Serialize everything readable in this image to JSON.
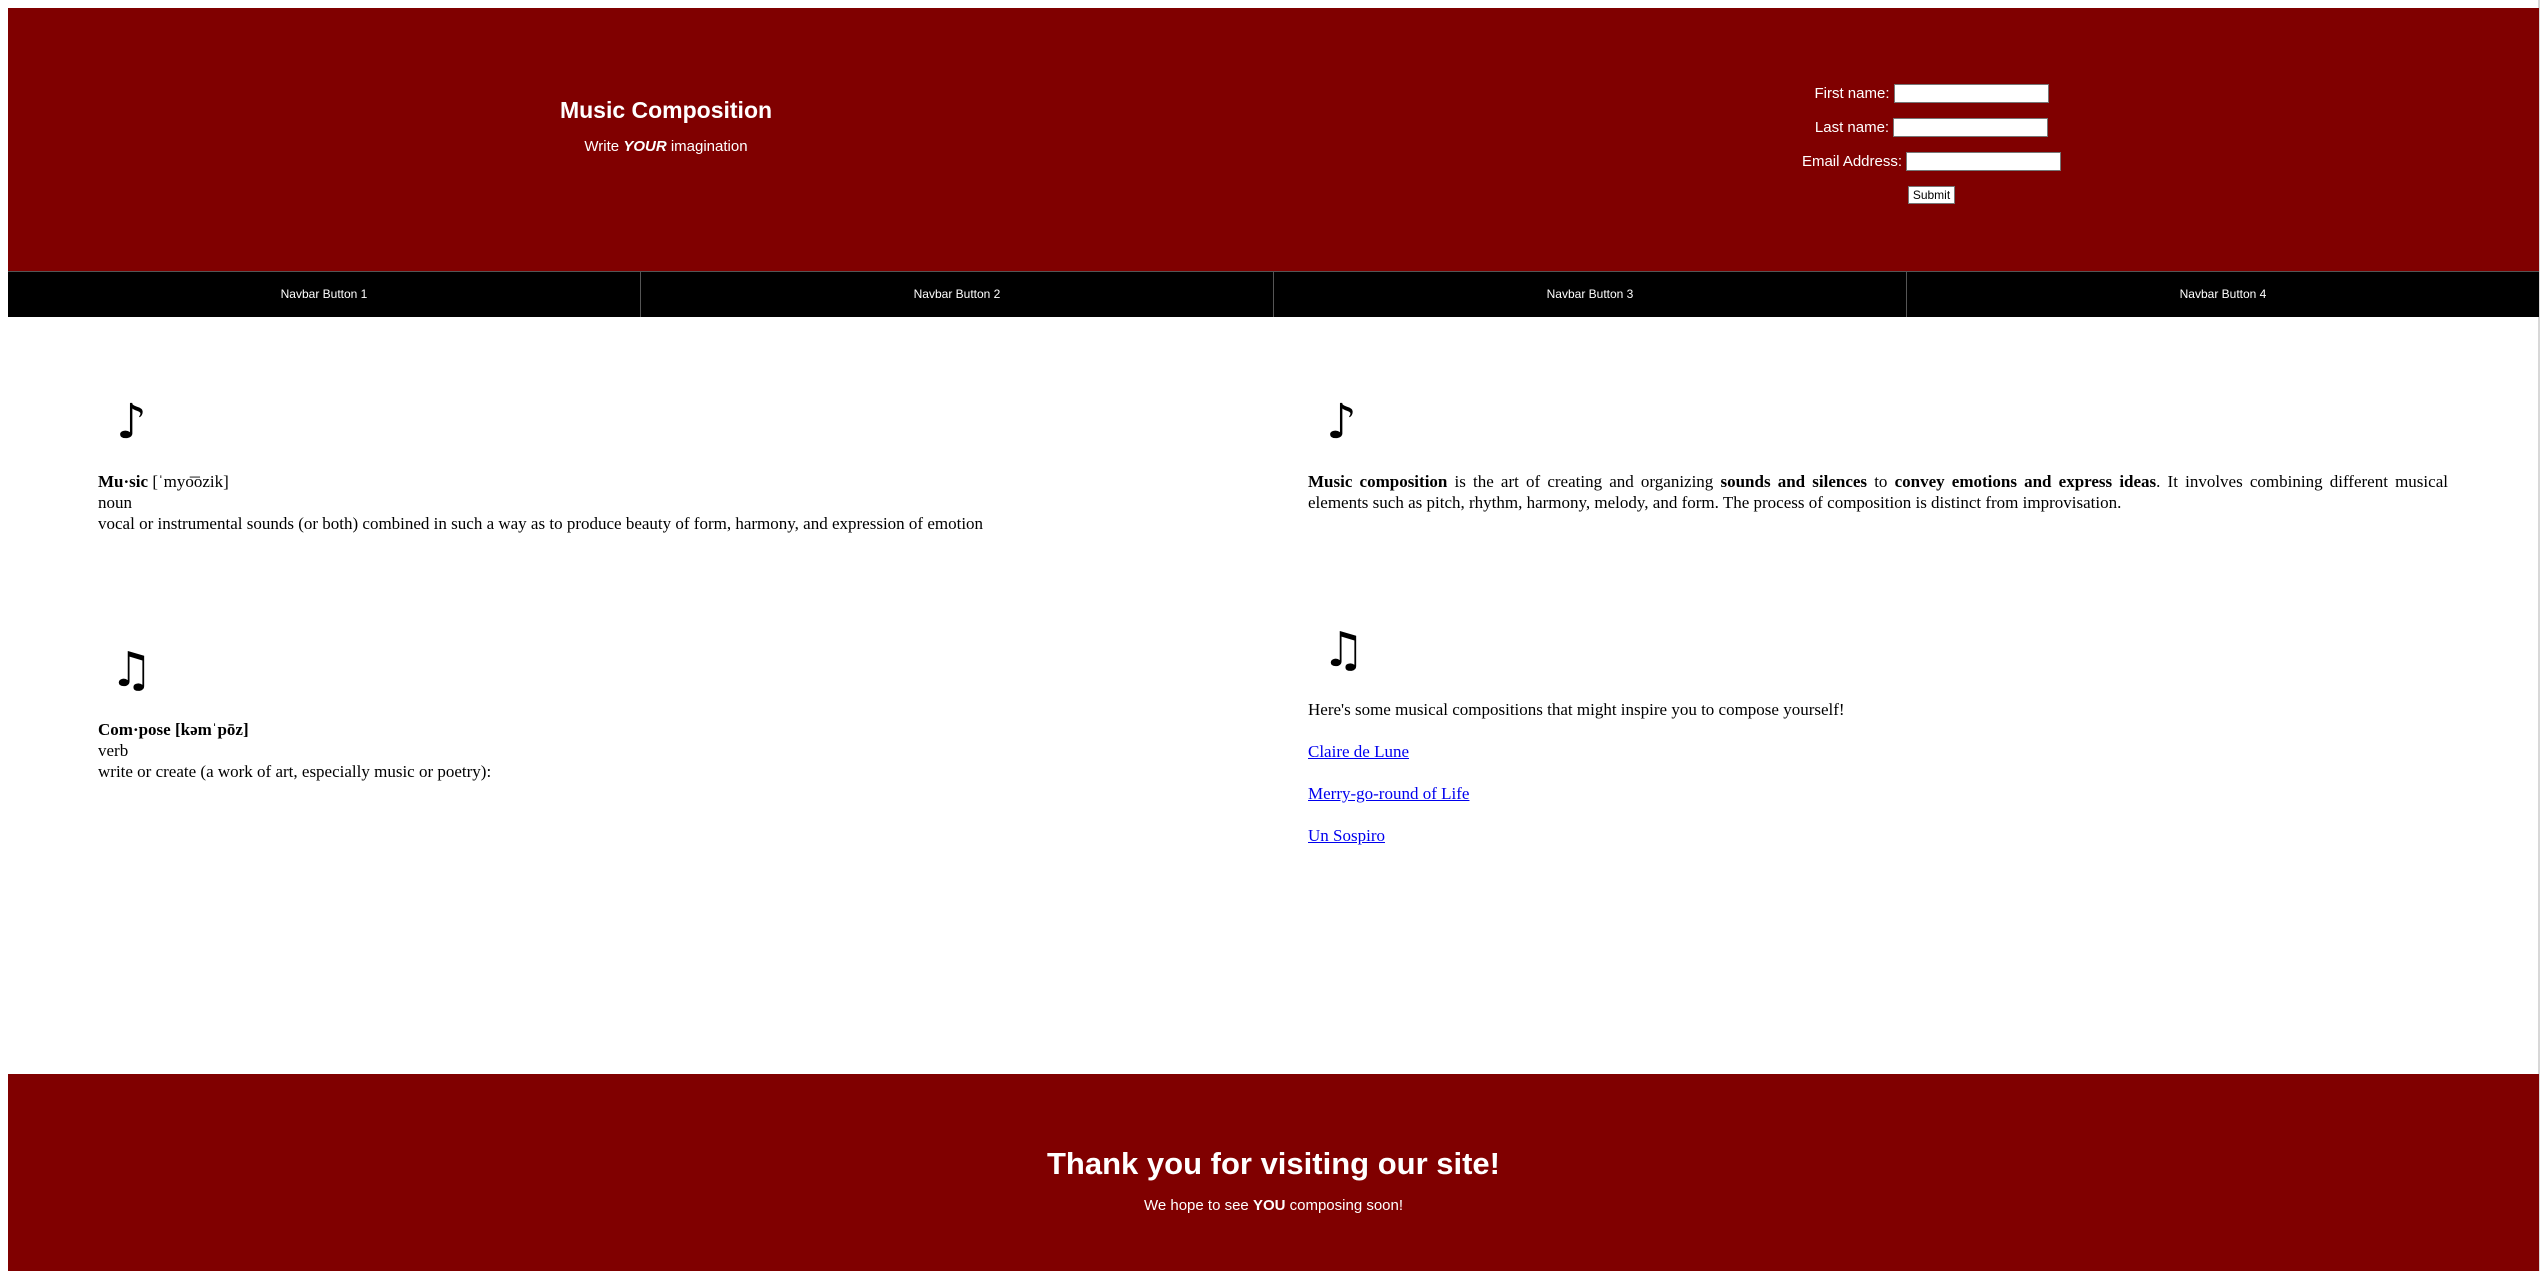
{
  "header": {
    "title": "Music Composition",
    "tagline_before": "Write ",
    "tagline_emphasis": "YOUR",
    "tagline_after": " imagination",
    "form": {
      "first_name_label": "First name:",
      "last_name_label": "Last name:",
      "email_label": "Email Address:",
      "first_name_value": "",
      "last_name_value": "",
      "email_value": "",
      "submit_label": "Submit"
    }
  },
  "navbar": {
    "items": [
      {
        "label": "Navbar Button 1"
      },
      {
        "label": "Navbar Button 2"
      },
      {
        "label": "Navbar Button 3"
      },
      {
        "label": "Navbar Button 4"
      }
    ]
  },
  "music_definition": {
    "icon": "♪",
    "word": "Mu·sic",
    "pronunciation": " [ˈmyo͞ozik]",
    "part_of_speech": "noun",
    "definition": "vocal or instrumental sounds (or both) combined in such a way as to produce beauty of form, harmony, and expression of emotion"
  },
  "compose_definition": {
    "icon": "♫",
    "word": "Com·pose [kəmˈpōz]",
    "part_of_speech": "verb",
    "definition": "write or create (a work of art, especially music or poetry):"
  },
  "composition_info": {
    "icon": "♪",
    "bold_1": "Music composition",
    "text_1": " is the art of creating and organizing ",
    "bold_2": "sounds and silences",
    "text_2": " to ",
    "bold_3": "convey emotions and express ideas",
    "text_3": ". It involves combining different musical elements such as pitch, rhythm, harmony, melody, and form. The process of composition is distinct from improvisation."
  },
  "inspiration": {
    "icon": "♫",
    "intro": "Here's some musical compositions that might inspire you to compose yourself!",
    "links": [
      {
        "label": "Claire de Lune"
      },
      {
        "label": "Merry-go-round of Life"
      },
      {
        "label": "Un Sospiro"
      }
    ]
  },
  "footer": {
    "heading": "Thank you for visiting our site!",
    "text_before": "We hope to see ",
    "text_emphasis": "YOU",
    "text_after": " composing soon!"
  },
  "colors": {
    "banner": "#800000",
    "navbar": "#000000",
    "link": "#0000ee"
  }
}
